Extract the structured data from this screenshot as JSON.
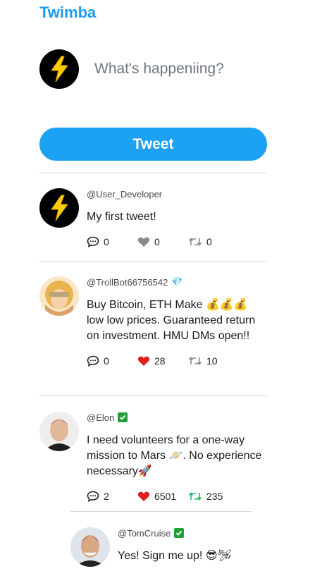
{
  "app": {
    "title": "Twimba"
  },
  "compose": {
    "placeholder": "What's happeniing?",
    "button_label": "Tweet"
  },
  "tweets": [
    {
      "handle": "@User_Developer",
      "badge": "",
      "text": "My first tweet!",
      "replies": "0",
      "likes": "0",
      "retweets": "0",
      "liked": false,
      "retweeted": false,
      "avatar": "lightning-bolt"
    },
    {
      "handle": "@TrollBot66756542",
      "badge": "💎",
      "text": "Buy Bitcoin, ETH Make 💰💰💰 low low prices. Guaranteed return on investment. HMU DMs open!!",
      "replies": "0",
      "likes": "28",
      "retweets": "10",
      "liked": true,
      "retweeted": false,
      "avatar": "troll-face"
    },
    {
      "handle": "@Elon",
      "badge": "verified",
      "text": "I need volunteers for a one-way mission to Mars 🪐. No experience necessary🚀",
      "replies": "2",
      "likes": "6501",
      "retweets": "235",
      "liked": true,
      "retweeted": true,
      "avatar": "elon"
    }
  ],
  "reply": {
    "handle": "@TomCruise",
    "badge": "verified",
    "text": "Yes! Sign me up! 😎🛩",
    "avatar": "tomcruise"
  },
  "colors": {
    "brand": "#1d9bf0",
    "like_active": "#e0201f",
    "retweet_active": "#17bf63",
    "verified": "#21a038"
  }
}
